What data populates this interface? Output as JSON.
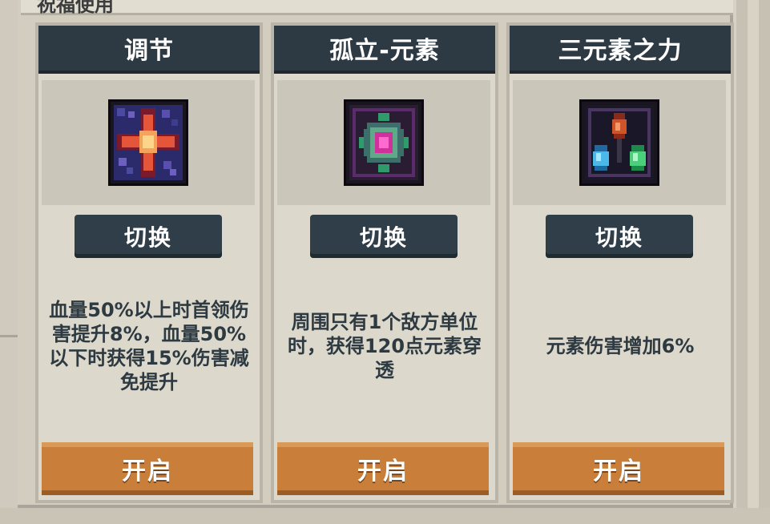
{
  "panel": {
    "title": "祝福使用"
  },
  "cards": [
    {
      "title": "调节",
      "icon": "regulate-cross-icon",
      "switch_label": "切换",
      "description": "血量50%以上时首领伤害提升8%，血量50%以下时获得15%伤害减免提升",
      "open_label": "开启"
    },
    {
      "title": "孤立-元素",
      "icon": "isolated-element-gem-icon",
      "switch_label": "切换",
      "description": "周围只有1个敌方单位时，获得120点元素穿透",
      "open_label": "开启"
    },
    {
      "title": "三元素之力",
      "icon": "three-element-crystals-icon",
      "switch_label": "切换",
      "description": "元素伤害增加6%",
      "open_label": "开启"
    }
  ],
  "colors": {
    "card_header": "#2d3a44",
    "switch_button": "#2f3e48",
    "open_button": "#c97f3a",
    "card_background": "#dcd8cb",
    "description_text": "#2e3a42"
  }
}
